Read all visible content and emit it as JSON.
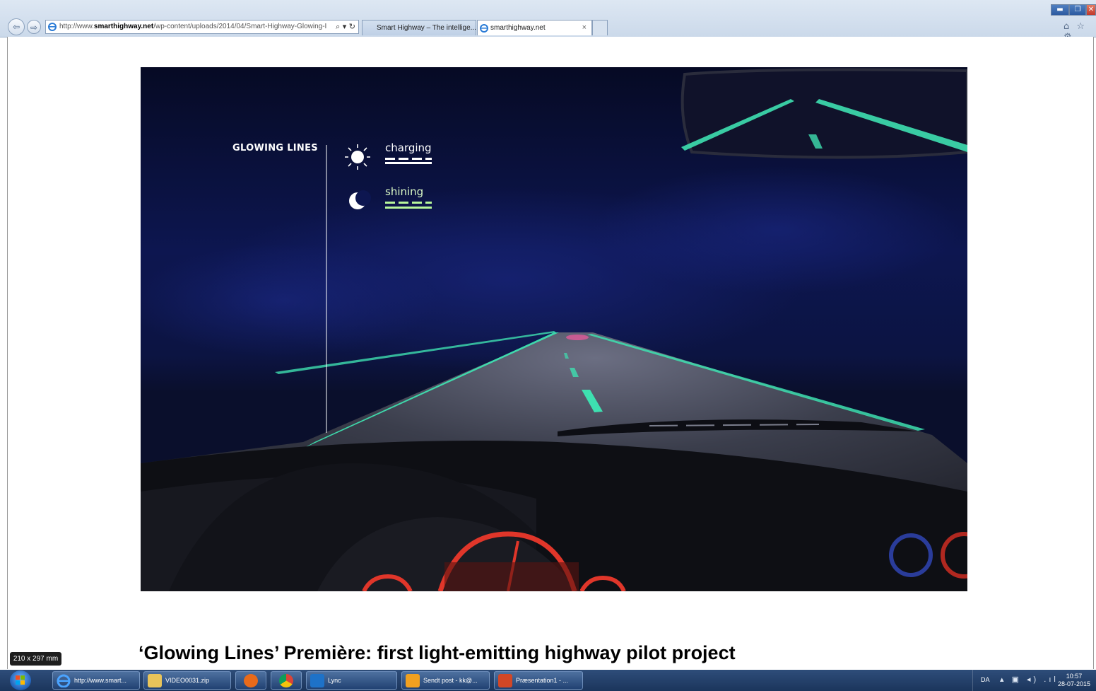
{
  "browser": {
    "url_prefix": "http://www.",
    "url_domain": "smarthighway.net",
    "url_path": "/wp-content/uploads/2014/04/Smart-Highway-Glowing-I",
    "address_tools": "⌕ ▾ ↻",
    "tabs": [
      {
        "label": "Smart Highway – The intellige..."
      },
      {
        "label": "smarthighway.net",
        "close": "×"
      }
    ],
    "window_controls": {
      "min": "▬",
      "max": "❐",
      "close": "✕"
    },
    "toolbar_icons": "⌂ ☆ ⚙"
  },
  "slide": {
    "overlay_title": "GLOWING LINES",
    "charging_label": "charging",
    "shining_label": "shining",
    "caption": "‘Glowing Lines’ Première: first light-emitting highway pilot project",
    "paper_size": "210 x 297 mm"
  },
  "taskbar": {
    "items": [
      {
        "label": "http://www.smart...",
        "icon": "ie-icon"
      },
      {
        "label": "VIDEO0031.zip",
        "icon": "folder-icon"
      },
      {
        "label": "",
        "icon": "media-player-icon"
      },
      {
        "label": "",
        "icon": "chrome-icon"
      },
      {
        "label": "Lync",
        "icon": "lync-icon"
      },
      {
        "label": "Sendt post - kk@...",
        "icon": "outlook-icon"
      },
      {
        "label": "Præsentation1 - ...",
        "icon": "powerpoint-icon"
      }
    ],
    "tray": {
      "lang": "DA",
      "icons": "▴ ▣ ◂) .ıl",
      "time": "10:57",
      "date": "28-07-2015"
    }
  },
  "colors": {
    "glow_green": "#3ee0b0",
    "dash_green": "#b8f79a",
    "sky": "#0c1340",
    "taskbar": "#22406b"
  }
}
